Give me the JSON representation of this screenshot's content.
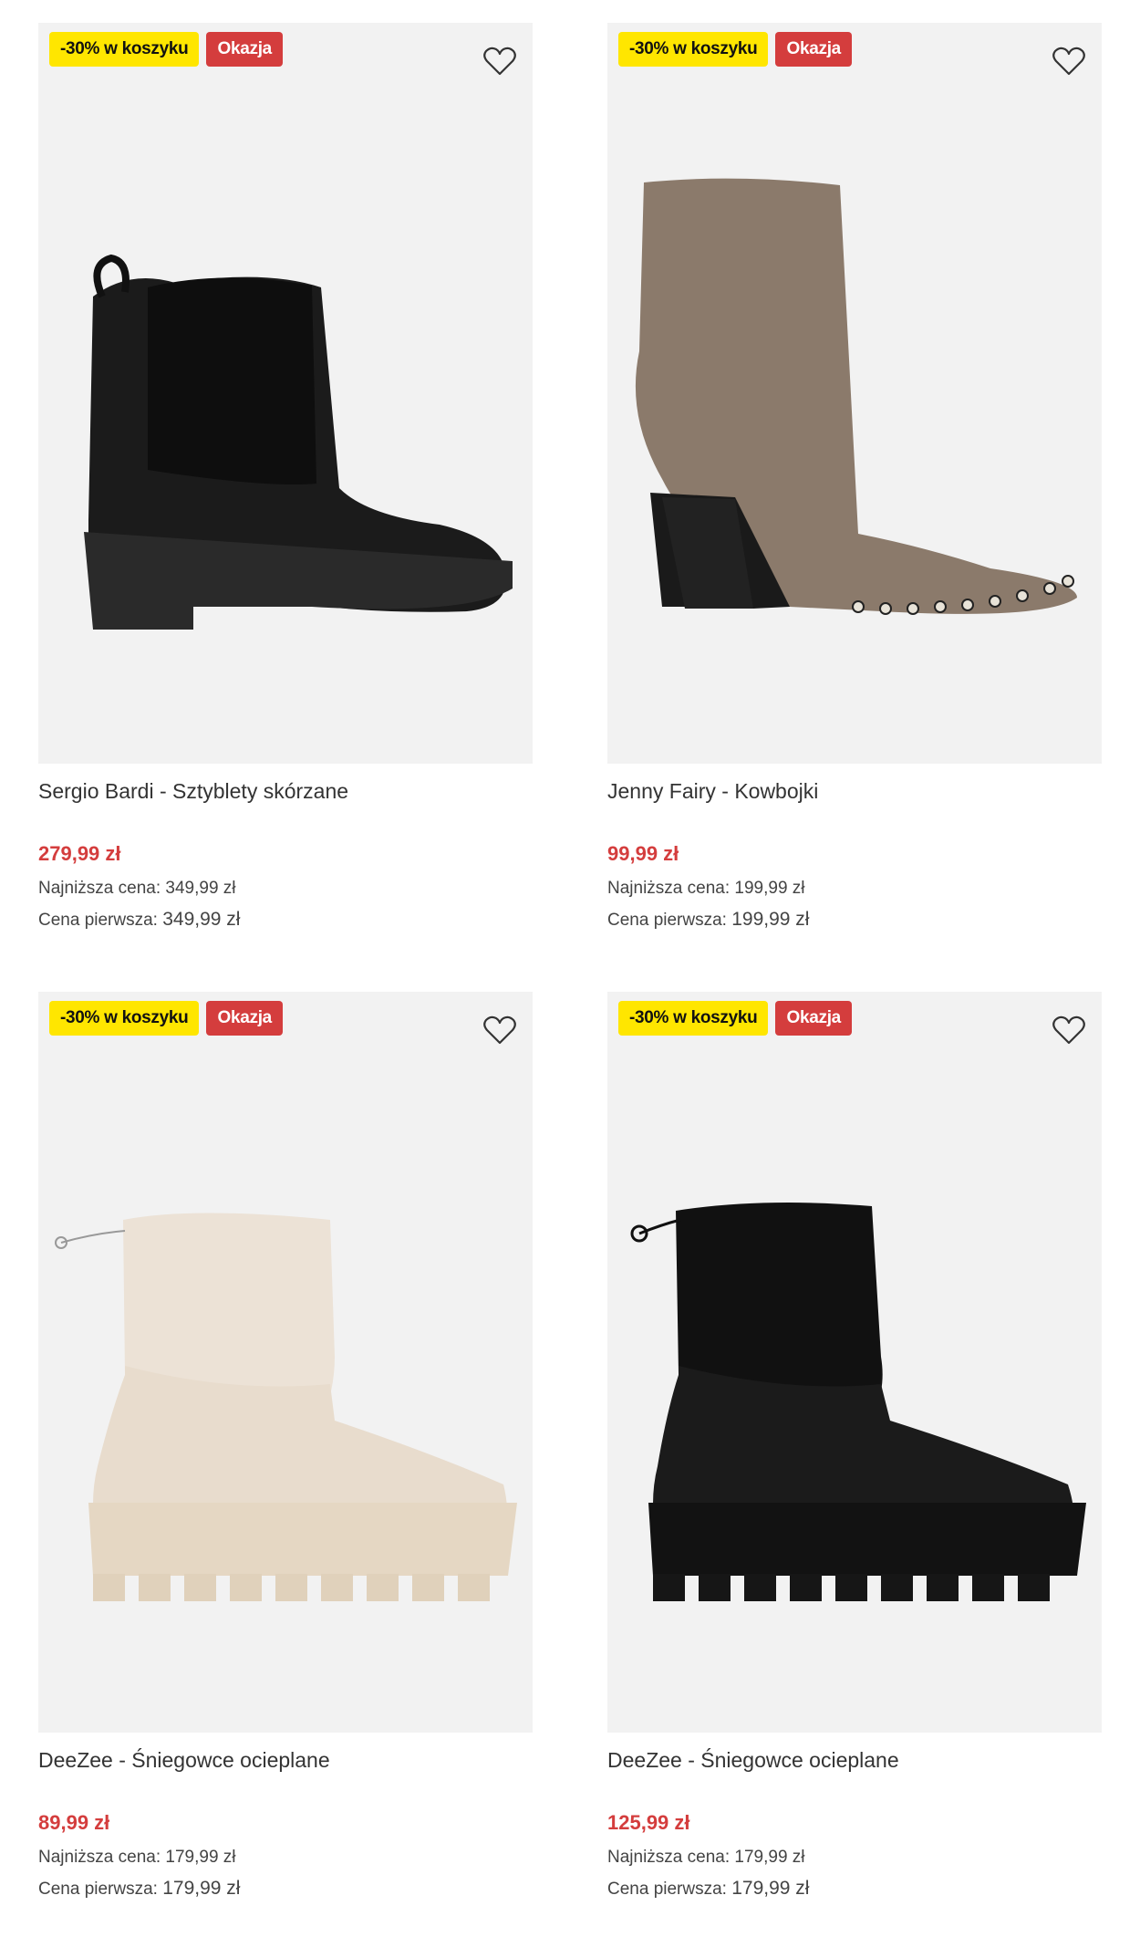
{
  "badges": {
    "promo": "-30% w koszyku",
    "deal": "Okazja"
  },
  "products": [
    {
      "name": "Sergio Bardi - Sztyblety skórzane",
      "price": "279,99 zł",
      "lowest_label": "Najniższa cena:",
      "lowest_value": "349,99 zł",
      "first_label": "Cena pierwsza:",
      "first_value": "349,99 zł",
      "icon": "heart-icon"
    },
    {
      "name": "Jenny Fairy - Kowbojki",
      "price": "99,99 zł",
      "lowest_label": "Najniższa cena:",
      "lowest_value": "199,99 zł",
      "first_label": "Cena pierwsza:",
      "first_value": "199,99 zł",
      "icon": "heart-icon"
    },
    {
      "name": "DeeZee - Śniegowce ocieplane",
      "price": "89,99 zł",
      "lowest_label": "Najniższa cena:",
      "lowest_value": "179,99 zł",
      "first_label": "Cena pierwsza:",
      "first_value": "179,99 zł",
      "icon": "heart-icon"
    },
    {
      "name": "DeeZee - Śniegowce ocieplane",
      "price": "125,99 zł",
      "lowest_label": "Najniższa cena:",
      "lowest_value": "179,99 zł",
      "first_label": "Cena pierwsza:",
      "first_value": "179,99 zł",
      "icon": "heart-icon"
    }
  ],
  "colors": {
    "promo_bg": "#ffe600",
    "deal_bg": "#d43d3d",
    "price": "#d43d3d",
    "image_bg": "#f2f2f2"
  }
}
